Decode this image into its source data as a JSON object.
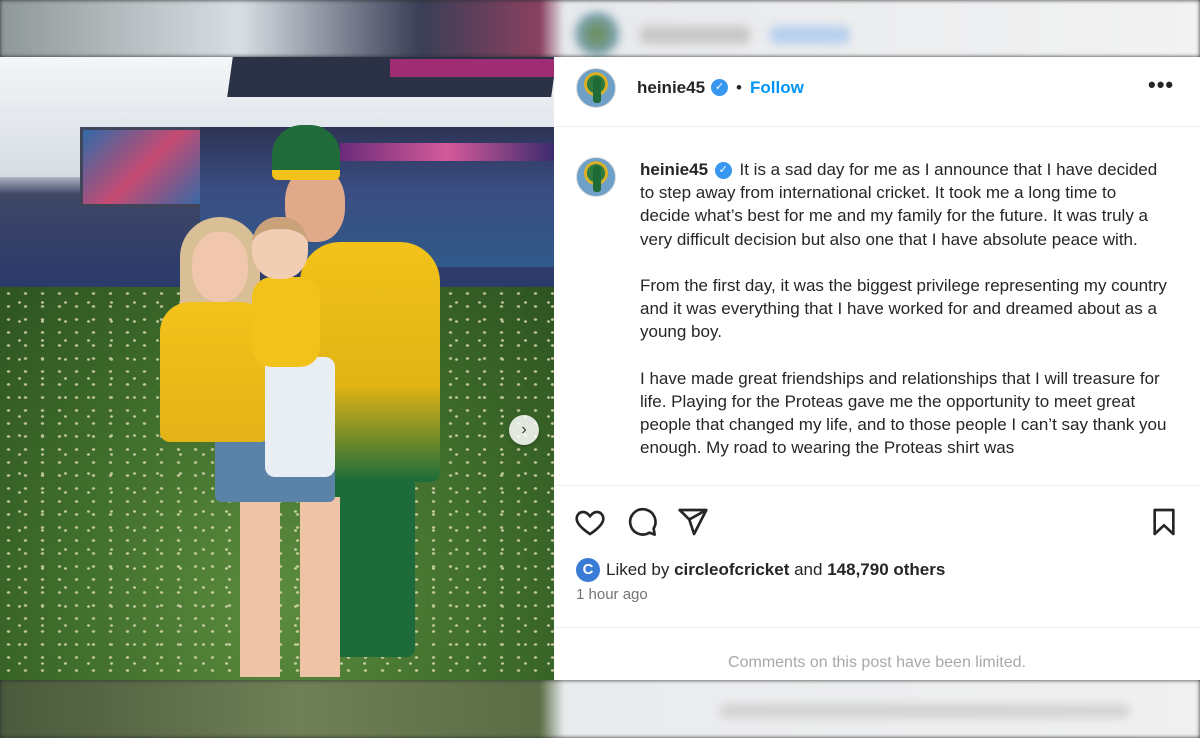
{
  "post": {
    "username": "heinie45",
    "verified_mark": "✓",
    "separator": "•",
    "follow_label": "Follow",
    "more_label": "•••",
    "caption_paragraphs": [
      "It is a sad day for me as I announce that I have decided to step away from international cricket. It took me a long time to decide what’s best for me and my family for the future. It was truly a very difficult decision but also one that I have absolute peace with.",
      "From the first day, it was the biggest privilege representing my country and it was everything that I have worked for and dreamed about as a young boy.",
      "I have made great friendships and relationships that I will treasure for life. Playing for the Proteas gave me the opportunity to meet great people that changed my life, and to those people I can’t say thank you enough. My road to wearing the Proteas shirt was"
    ],
    "likes": {
      "liker_avatar_letter": "C",
      "prefix": "Liked by ",
      "liker": "circleofcricket",
      "middle": " and ",
      "count": "148,790 others"
    },
    "timestamp": "1 hour ago",
    "comments_notice": "Comments on this post have been limited."
  },
  "photo": {
    "next_arrow": "›"
  },
  "icons": {
    "like": "heart-icon",
    "comment": "comment-bubble-icon",
    "share": "paper-plane-icon",
    "save": "bookmark-icon",
    "next": "chevron-right-icon"
  },
  "colors": {
    "accent": "#0095f6",
    "verified": "#3897f0",
    "muted_text": "#737373",
    "limited_text": "#a8a8a8"
  }
}
